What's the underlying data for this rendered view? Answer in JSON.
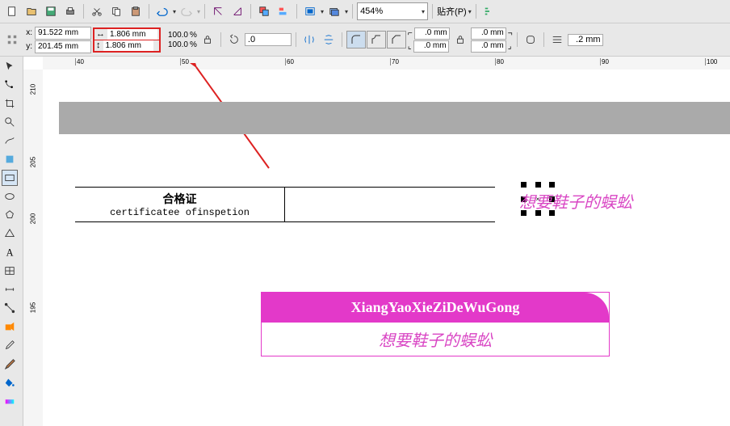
{
  "toolbar": {
    "zoom": "454%",
    "snap_label": "贴齐(P)",
    "angle": ".0"
  },
  "coords": {
    "x_label": "x:",
    "y_label": "y:",
    "x": "91.522 mm",
    "y": "201.45 mm",
    "w": "1.806 mm",
    "h": "1.806 mm"
  },
  "pct": {
    "w": "100.0",
    "h": "100.0"
  },
  "mm": {
    "val1": ".0 mm",
    "val2": ".0 mm",
    "val3": ".0 mm",
    "val4": ".0 mm",
    "val5": ".2 mm"
  },
  "ruler_h": [
    "40",
    "50",
    "60",
    "70",
    "80",
    "90",
    "100"
  ],
  "ruler_v": [
    "210",
    "205",
    "200",
    "195"
  ],
  "cert": {
    "title": "合格证",
    "subtitle": "certificatee ofinspetion"
  },
  "watermark": "想要鞋子的蜈蚣",
  "card": {
    "title": "XiangYaoXieZiDeWuGong",
    "subtitle": "想要鞋子的蜈蚣"
  }
}
